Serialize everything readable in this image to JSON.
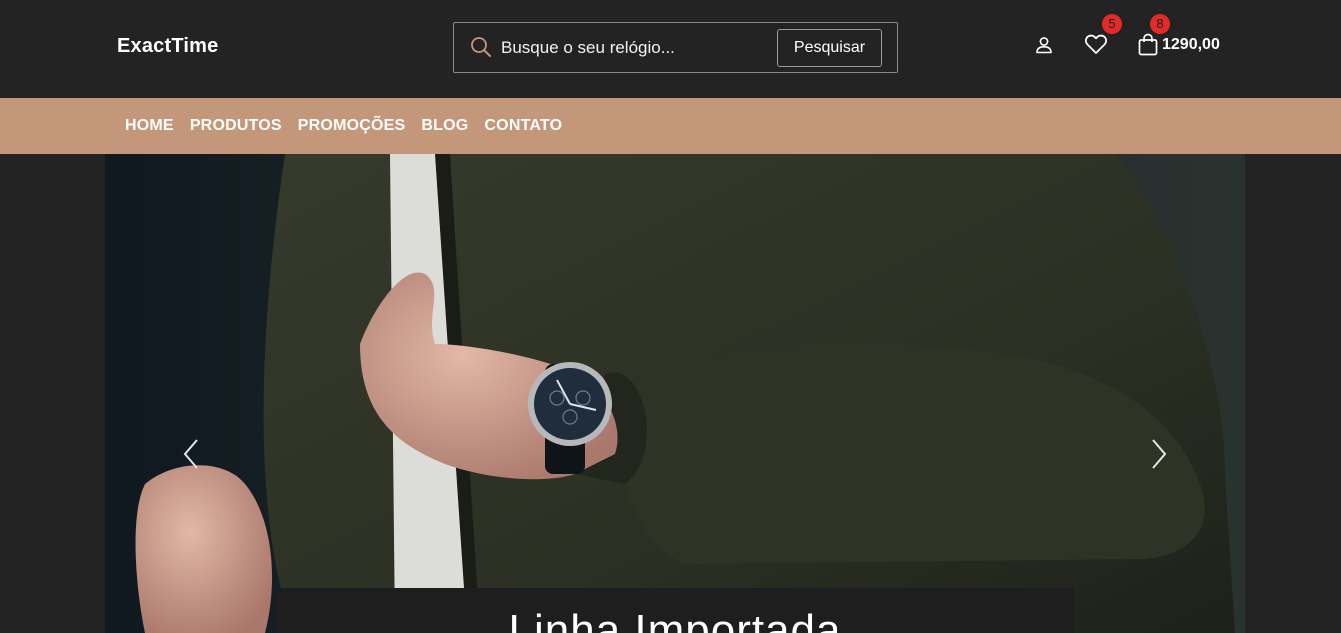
{
  "header": {
    "logo": "ExactTime",
    "search": {
      "placeholder": "Busque o seu relógio...",
      "button_label": "Pesquisar"
    },
    "favorites_count": "5",
    "cart_count": "8",
    "cart_total": "1290,00"
  },
  "nav": {
    "items": [
      "HOME",
      "PRODUTOS",
      "PROMOÇÕES",
      "BLOG",
      "CONTATO"
    ]
  },
  "banner": {
    "caption": "Linha Importada"
  },
  "colors": {
    "background": "#232323",
    "nav_background": "#c4977a",
    "badge": "#e32a2a",
    "search_icon": "#c4977a"
  },
  "icons": [
    "search-icon",
    "user-icon",
    "heart-icon",
    "shopping-bag-icon",
    "chevron-left-icon",
    "chevron-right-icon"
  ]
}
